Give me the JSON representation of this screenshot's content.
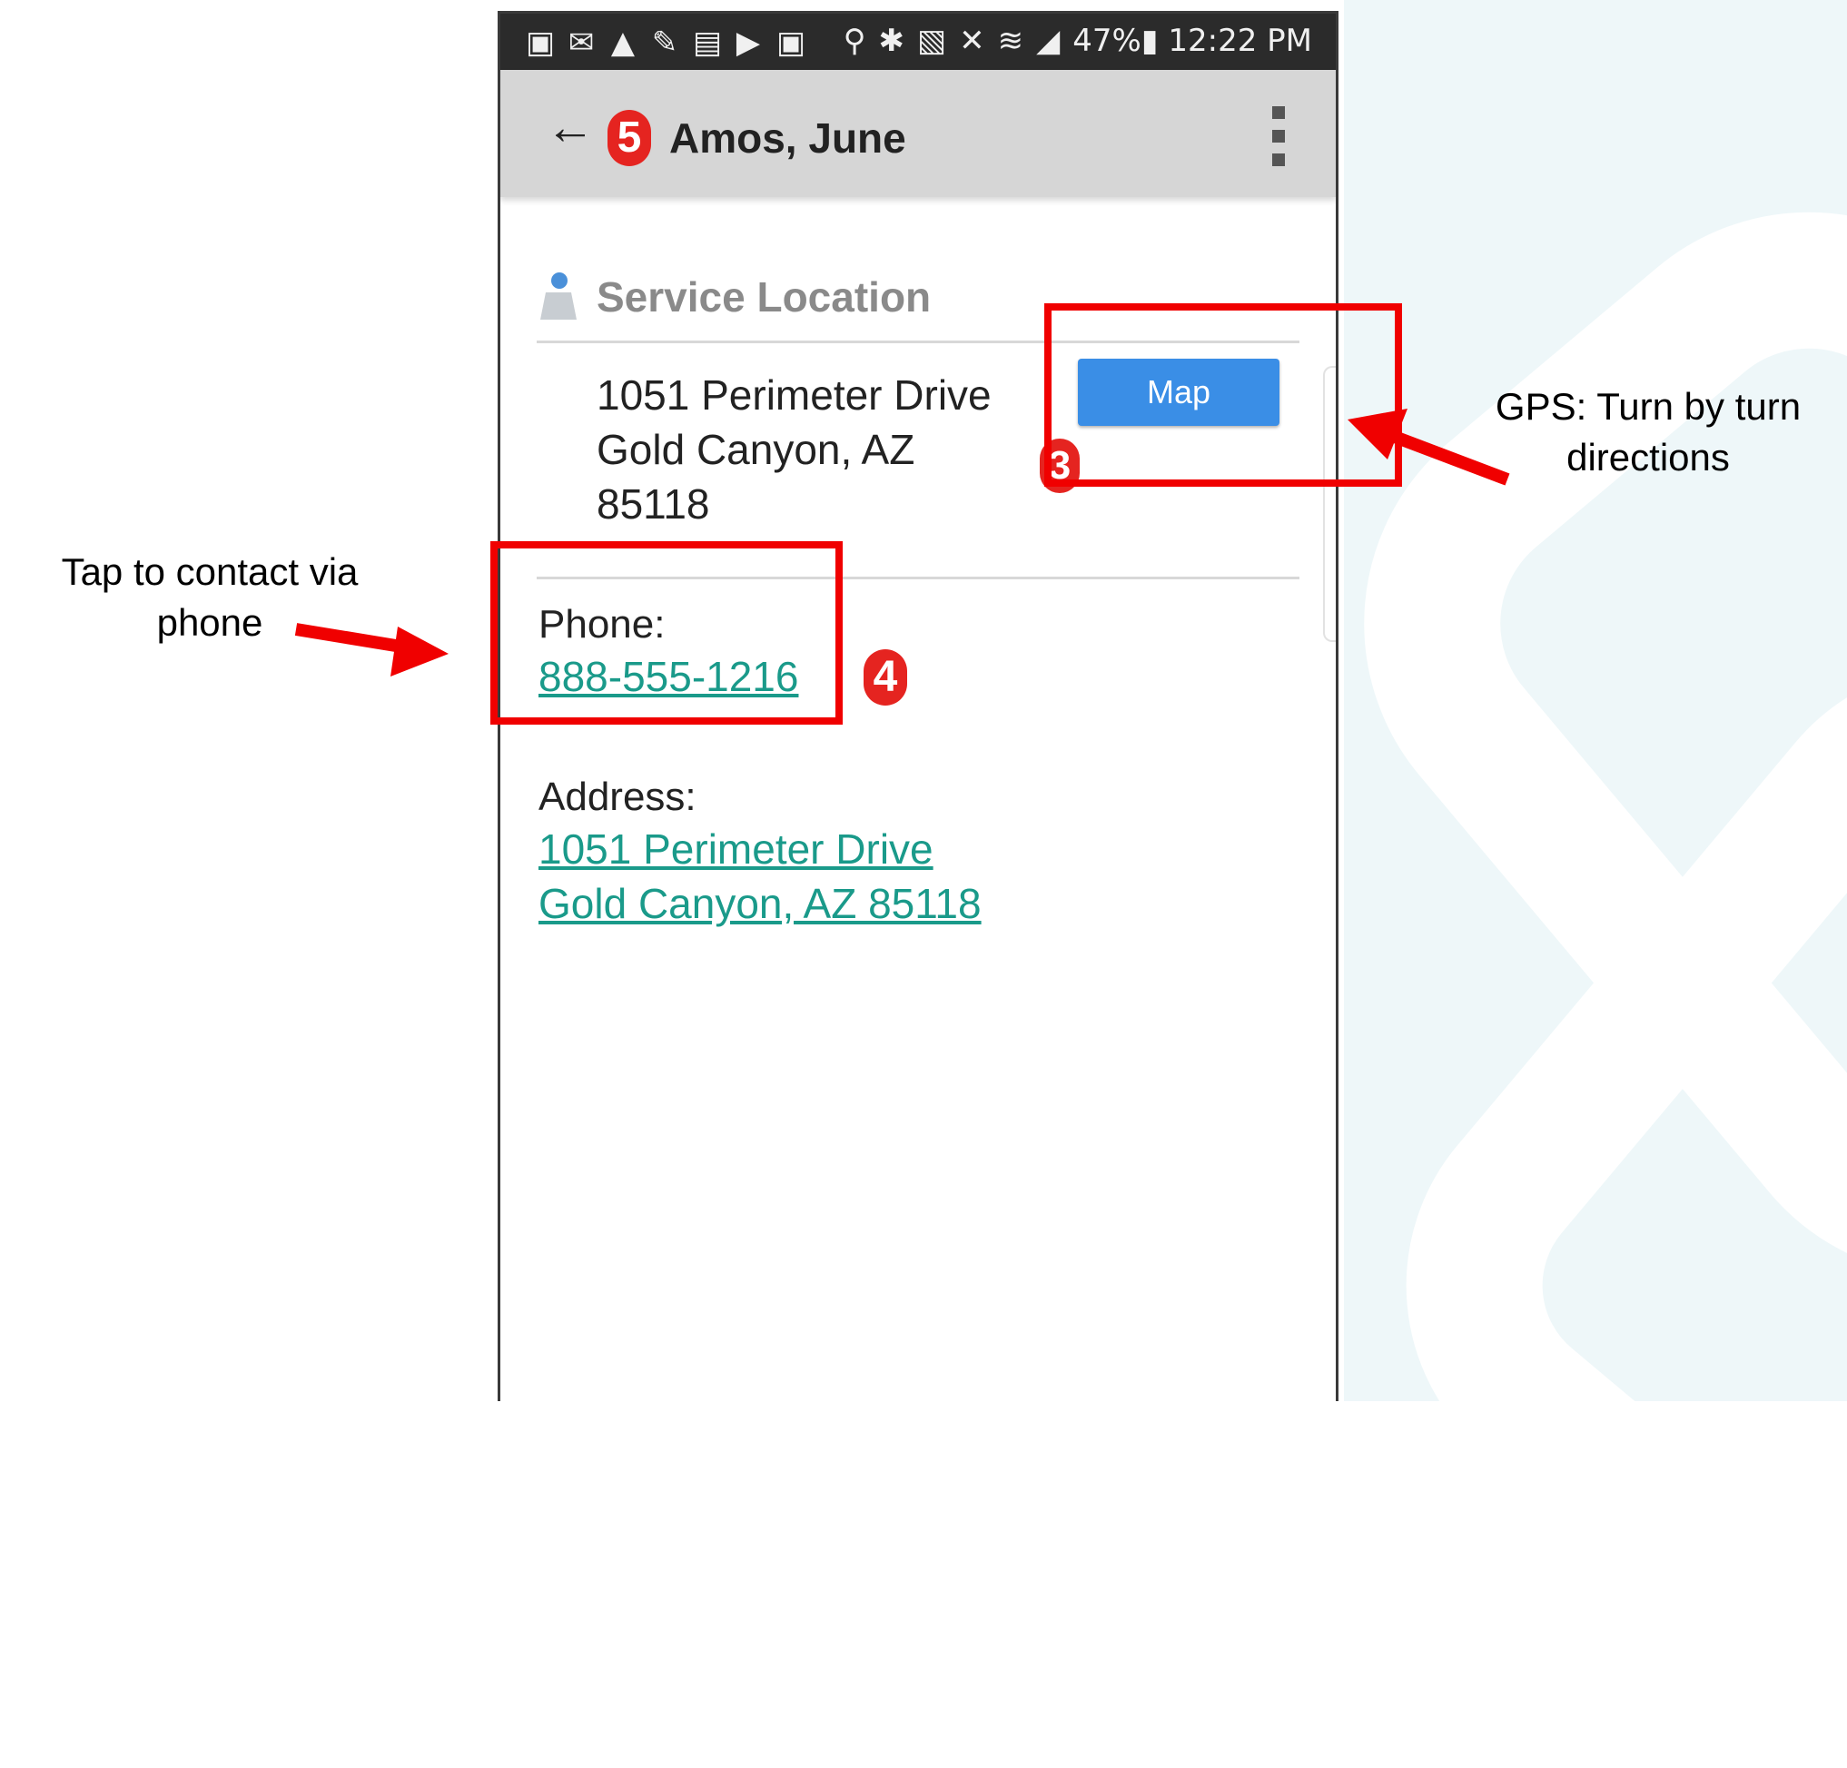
{
  "status_bar": {
    "left_icons": [
      "app-icon",
      "mail-icon",
      "warning-icon",
      "wrench-icon",
      "image-icon",
      "play-icon",
      "app-icon"
    ],
    "right_text": "47%▮ 12:22 PM",
    "right_icons": [
      "location-icon",
      "bluetooth-icon",
      "nfc-icon",
      "mute-icon",
      "wifi-icon",
      "signal-icon"
    ]
  },
  "app_bar": {
    "back_icon": "←",
    "badge": "5",
    "title": "Amos, June"
  },
  "service_location": {
    "heading": "Service Location",
    "address_lines": [
      "1051 Perimeter Drive",
      "Gold Canyon, AZ",
      "85118"
    ],
    "map_button": "Map",
    "badge": "3"
  },
  "phone": {
    "label": "Phone:",
    "number": "888-555-1216",
    "badge": "4"
  },
  "address": {
    "label": "Address:",
    "line1": "1051 Perimeter Drive",
    "line2": "Gold Canyon, AZ 85118"
  },
  "annotations": {
    "gps": "GPS: Turn by turn directions",
    "phone": "Tap to contact via phone"
  },
  "colors": {
    "highlight": "#f00000",
    "link": "#1a9a8a",
    "map_button": "#3a8ee6",
    "badge": "#e52420"
  }
}
